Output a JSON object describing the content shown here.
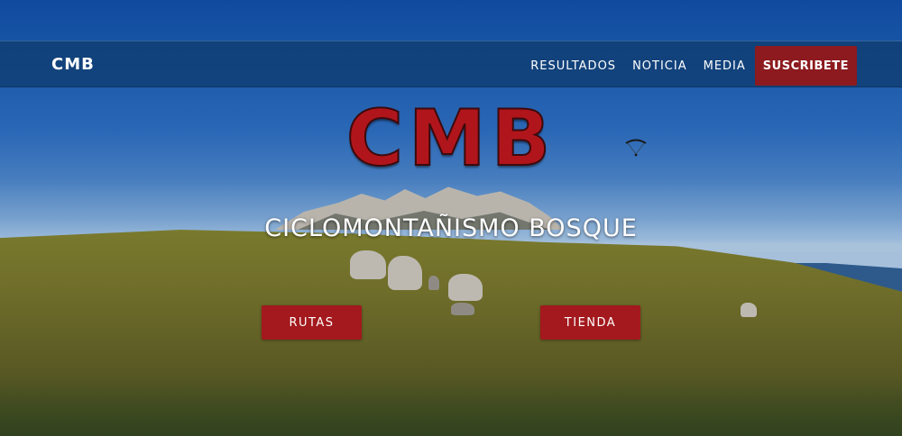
{
  "nav": {
    "brand": "CMB",
    "links": [
      "RESULTADOS",
      "NOTICIA",
      "MEDIA"
    ],
    "cta": "SUSCRIBETE"
  },
  "hero": {
    "logo_text": "CMB",
    "subtitle": "CICLOMONTAÑISMO BOSQUE",
    "buttons": [
      "RUTAS",
      "TIENDA"
    ]
  },
  "colors": {
    "nav_bg": "#103c6e",
    "accent_red": "#a3191d",
    "cta_red": "#8c1a1e"
  },
  "icons": {
    "paraglider": "paraglider-icon"
  }
}
